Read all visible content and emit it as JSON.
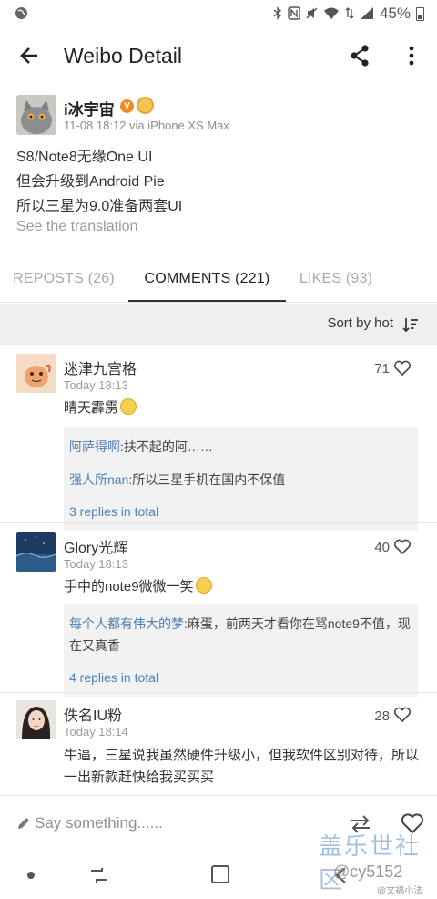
{
  "status_bar": {
    "battery": "45%"
  },
  "app_bar": {
    "title": "Weibo Detail"
  },
  "post": {
    "author": "i冰宇宙",
    "meta": "11-08 18:12 via iPhone XS Max",
    "lines": [
      "S8/Note8无缘One UI",
      "但会升级到Android Pie",
      "所以三星为9.0准备两套UI"
    ],
    "see_translation": "See the translation"
  },
  "tabs": [
    {
      "label": "REPOSTS (26)",
      "active": false
    },
    {
      "label": "COMMENTS (221)",
      "active": true
    },
    {
      "label": "LIKES (93)",
      "active": false
    }
  ],
  "sort": {
    "label": "Sort by hot"
  },
  "comments": [
    {
      "name": "迷津九宫格",
      "time": "Today 18:13",
      "likes": "71",
      "text": "晴天霹雳",
      "replies": [
        {
          "user": "阿萨得啊",
          "text": ":扶不起的阿……"
        },
        {
          "user": "强人所nan",
          "text": ":所以三星手机在国内不保值"
        }
      ],
      "replies_total": "3 replies in total"
    },
    {
      "name": "Glory光辉",
      "time": "Today 18:13",
      "likes": "40",
      "text": "手中的note9微微一笑",
      "replies": [
        {
          "user": "每个人都有伟大的梦",
          "text": ":麻蛋，前两天才看你在骂note9不值，现在又真香"
        }
      ],
      "replies_total": "4 replies in total"
    },
    {
      "name": "佚名IU粉",
      "time": "Today 18:14",
      "likes": "28",
      "text": "牛逼，三星说我虽然硬件升级小，但我软件区别对待，所以一出新款赶快给我买买买"
    }
  ],
  "input": {
    "placeholder": "Say something......"
  },
  "watermark": {
    "forum": "盖乐世社区",
    "handle": "@cy5152",
    "weibo": "@文福小法"
  }
}
